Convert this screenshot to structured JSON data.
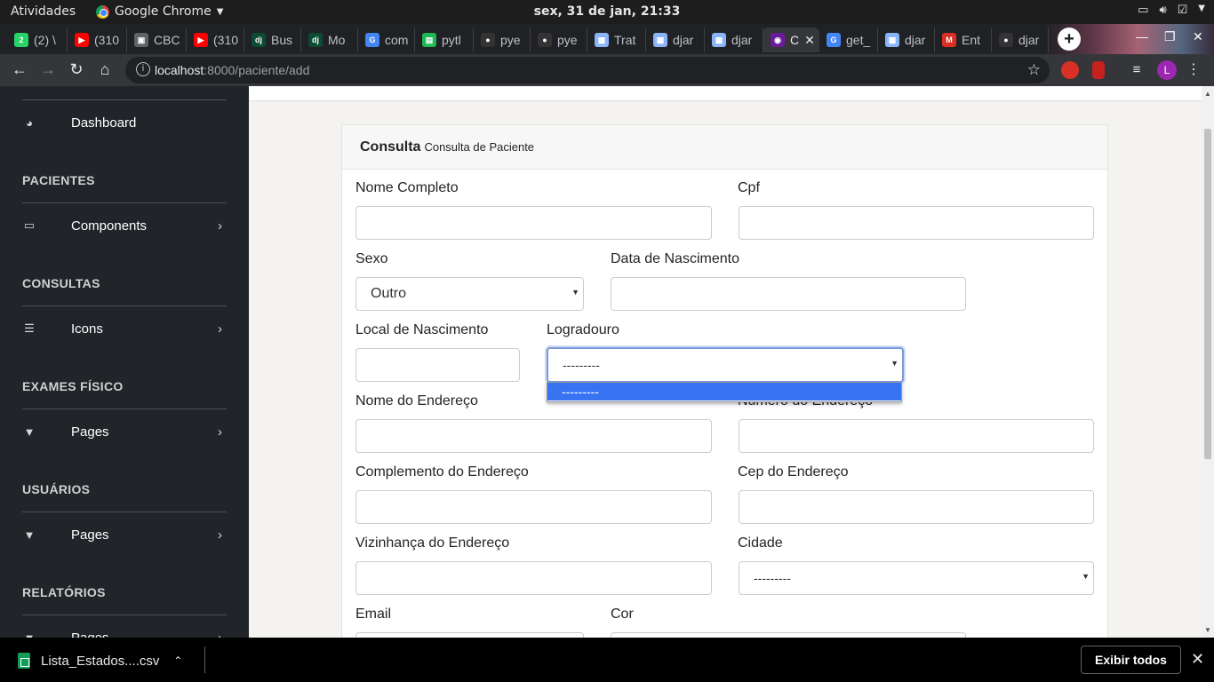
{
  "system": {
    "activities": "Atividades",
    "app_name": "Google Chrome",
    "clock": "sex, 31 de jan, 21:33"
  },
  "tabs": [
    {
      "label": "(2) \\",
      "icon": "whatsapp-icon",
      "color": "#25d366"
    },
    {
      "label": "(310",
      "icon": "youtube-icon",
      "color": "#ff0000"
    },
    {
      "label": "CBC",
      "icon": "document-icon",
      "color": "#5f6368"
    },
    {
      "label": "(310",
      "icon": "youtube-icon",
      "color": "#ff0000"
    },
    {
      "label": "Bus",
      "icon": "django-icon",
      "color": "#0c4b33"
    },
    {
      "label": "Mo",
      "icon": "django-icon",
      "color": "#0c4b33"
    },
    {
      "label": "com",
      "icon": "google-icon",
      "color": "#4285f4"
    },
    {
      "label": "pytl",
      "icon": "pypi-icon",
      "color": "#1db954"
    },
    {
      "label": "pye",
      "icon": "github-icon",
      "color": "#333333"
    },
    {
      "label": "pye",
      "icon": "github-icon",
      "color": "#333333"
    },
    {
      "label": "Trat",
      "icon": "grid-icon",
      "color": "#8ab4f8"
    },
    {
      "label": "djar",
      "icon": "grid-icon",
      "color": "#8ab4f8"
    },
    {
      "label": "djar",
      "icon": "grid-icon",
      "color": "#8ab4f8"
    },
    {
      "label": "C",
      "icon": "app-icon",
      "color": "#6a1b9a",
      "active": true
    },
    {
      "label": "get_",
      "icon": "google-icon",
      "color": "#4285f4"
    },
    {
      "label": "djar",
      "icon": "grid-icon",
      "color": "#8ab4f8"
    },
    {
      "label": "Ent",
      "icon": "gmail-icon",
      "color": "#d93025"
    },
    {
      "label": "djar",
      "icon": "github-icon",
      "color": "#333333"
    }
  ],
  "toolbar": {
    "url_host": "localhost",
    "url_path": ":8000/paciente/add",
    "avatar_letter": "L"
  },
  "sidebar": {
    "items": [
      {
        "label": "Dashboard",
        "icon": "dashboard-icon"
      },
      {
        "label": "Components",
        "icon": "laptop-icon"
      },
      {
        "label": "Icons",
        "icon": "list-icon"
      },
      {
        "label": "Pages",
        "icon": "filter-icon"
      },
      {
        "label": "Pages",
        "icon": "filter-icon"
      },
      {
        "label": "Pages",
        "icon": "filter-icon"
      }
    ],
    "sections": [
      "PACIENTES",
      "CONSULTAS",
      "EXAMES FÍSICO",
      "USUÁRIOS",
      "RELATÓRIOS"
    ]
  },
  "card": {
    "title": "Consulta",
    "subtitle": "Consulta de Paciente"
  },
  "form": {
    "nome_completo": "Nome Completo",
    "cpf": "Cpf",
    "sexo": "Sexo",
    "sexo_value": "Outro",
    "data_nascimento": "Data de Nascimento",
    "local_nascimento": "Local de Nascimento",
    "logradouro": "Logradouro",
    "logradouro_value": "---------",
    "logradouro_option": "---------",
    "nome_endereco": "Nome do Endereço",
    "numero_endereco": "Numero do Endereço",
    "complemento_endereco": "Complemento do Endereço",
    "cep_endereco": "Cep do Endereço",
    "vizinhanca_endereco": "Vizinhança do Endereço",
    "cidade": "Cidade",
    "cidade_value": "---------",
    "email": "Email",
    "cor": "Cor"
  },
  "downloads": {
    "file_name": "Lista_Estados....csv",
    "show_all": "Exibir todos"
  }
}
